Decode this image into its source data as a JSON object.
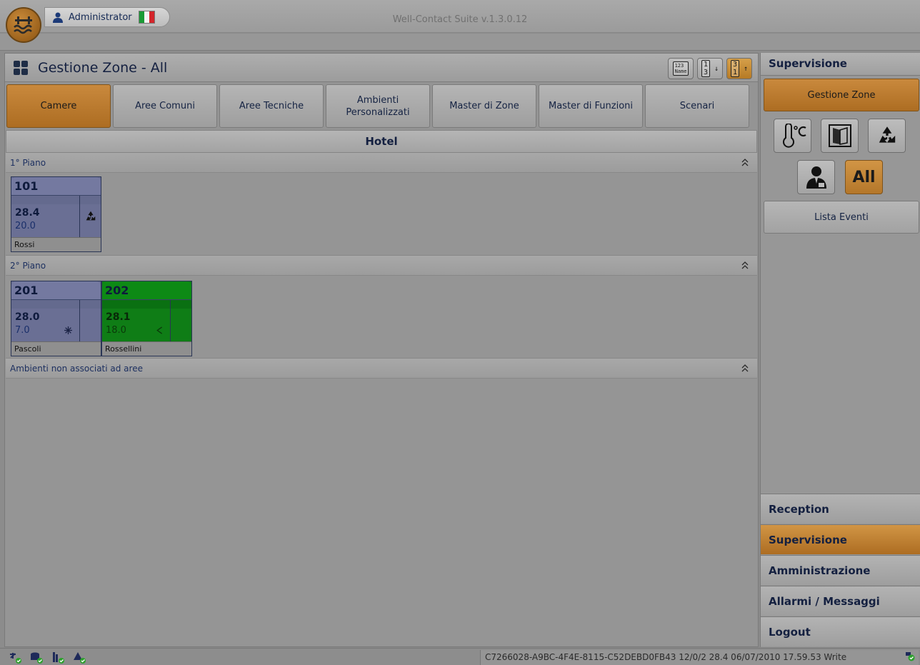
{
  "app": {
    "title": "Well-Contact Suite v.1.3.0.12",
    "user": "Administrator",
    "flag_colors": [
      "#1a9a35",
      "#f4f4f4",
      "#d4252b"
    ]
  },
  "main": {
    "title": "Gestione Zone - All",
    "sort_buttons": [
      {
        "label": "123 Name",
        "active": false
      },
      {
        "label": "1 3 ↓",
        "active": false
      },
      {
        "label": "3 1 ↑",
        "active": true
      }
    ],
    "tabs": [
      {
        "label": "Camere",
        "active": true
      },
      {
        "label": "Aree Comuni",
        "active": false
      },
      {
        "label": "Aree Tecniche",
        "active": false
      },
      {
        "label": "Ambienti Personalizzati",
        "active": false
      },
      {
        "label": "Master di Zone",
        "active": false
      },
      {
        "label": "Master di Funzioni",
        "active": false
      },
      {
        "label": "Scenari",
        "active": false
      }
    ],
    "section_title": "Hotel",
    "floors": [
      {
        "label": "1° Piano"
      },
      {
        "label": "2° Piano"
      },
      {
        "label": "Ambienti non associati ad aree"
      }
    ],
    "rooms": [
      {
        "number": "101",
        "temp": "28.4",
        "setpoint": "20.0",
        "guest": "Rossi",
        "status": "blue",
        "icon": "recycle-icon"
      },
      {
        "number": "201",
        "temp": "28.0",
        "setpoint": "7.0",
        "guest": "Pascoli",
        "status": "blue",
        "icon": "snowflake-icon"
      },
      {
        "number": "202",
        "temp": "28.1",
        "setpoint": "18.0",
        "guest": "Rossellini",
        "status": "green",
        "icon": "arrow-left-icon"
      }
    ]
  },
  "sidebar": {
    "header": "Supervisione",
    "gestione_zone_label": "Gestione Zone",
    "filters": [
      {
        "icon": "thermometer-icon",
        "active": false
      },
      {
        "icon": "door-icon",
        "active": false
      },
      {
        "icon": "recycle-icon",
        "active": false
      },
      {
        "icon": "staff-person-icon",
        "active": false
      },
      {
        "label": "All",
        "active": true
      }
    ],
    "lista_eventi_label": "Lista Eventi",
    "nav": [
      {
        "label": "Reception",
        "active": false
      },
      {
        "label": "Supervisione",
        "active": true
      },
      {
        "label": "Amministrazione",
        "active": false
      },
      {
        "label": "Allarmi / Messaggi",
        "active": false
      },
      {
        "label": "Logout",
        "active": false
      }
    ]
  },
  "status": {
    "text": "C7266028-A9BC-4F4E-8115-C52DEBD0FB43 12/0/2 28.4 06/07/2010 17.59.53 Write"
  }
}
